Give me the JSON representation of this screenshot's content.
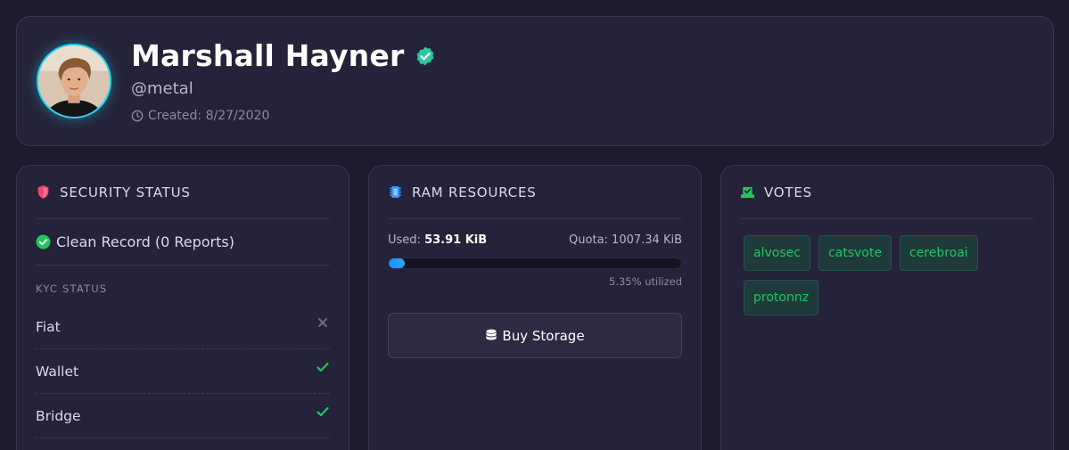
{
  "profile": {
    "name": "Marshall Hayner",
    "handle": "@metal",
    "created": "Created: 8/27/2020"
  },
  "security": {
    "title": "SECURITY STATUS",
    "clean_record": "Clean Record (0 Reports)",
    "kyc_label": "KYC STATUS",
    "kyc": [
      {
        "label": "Fiat",
        "status": "unverified",
        "icon": "x-icon"
      },
      {
        "label": "Wallet",
        "status": "verified",
        "icon": "check-icon"
      },
      {
        "label": "Bridge",
        "status": "verified",
        "icon": "check-icon"
      }
    ]
  },
  "ram": {
    "title": "RAM RESOURCES",
    "used_label": "Used:",
    "used_value": "53.91 KiB",
    "quota": "Quota: 1007.34 KiB",
    "utilized": "5.35% utilized",
    "utilization_percent": 5.35,
    "buy_label": "Buy Storage"
  },
  "votes": {
    "title": "VOTES",
    "items": [
      "alvosec",
      "catsvote",
      "cerebroai",
      "protonnz"
    ]
  },
  "colors": {
    "accent_cyan": "#20d3ee",
    "verified_teal": "#2fc5a0",
    "success_green": "#22c55e",
    "shield_pink": "#f0456e",
    "ram_blue": "#3b9cff",
    "background": "#1d1b2e",
    "card": "#252339"
  }
}
